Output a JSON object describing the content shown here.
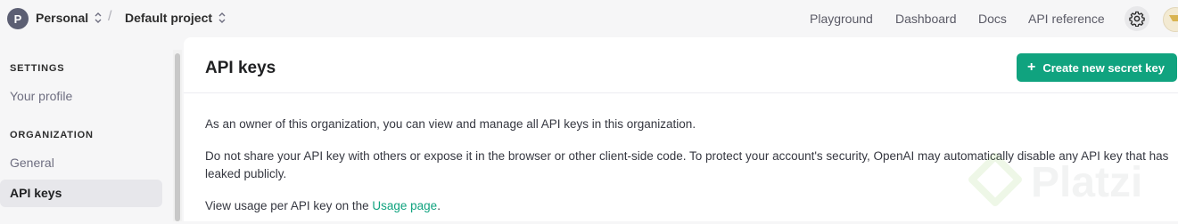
{
  "topbar": {
    "org_initial": "P",
    "org_name": "Personal",
    "separator": "/",
    "project_name": "Default project",
    "nav": [
      "Playground",
      "Dashboard",
      "Docs",
      "API reference"
    ]
  },
  "sidebar": {
    "sections": [
      {
        "heading": "SETTINGS",
        "items": [
          "Your profile"
        ]
      },
      {
        "heading": "ORGANIZATION",
        "items": [
          "General",
          "API keys"
        ]
      }
    ],
    "active_item": "API keys"
  },
  "main": {
    "title": "API keys",
    "create_button": "Create new secret key",
    "paragraphs": {
      "p1": "As an owner of this organization, you can view and manage all API keys in this organization.",
      "p2": "Do not share your API key with others or expose it in the browser or other client-side code. To protect your account's security, OpenAI may automatically disable any API key that has leaked publicly.",
      "p3_before": "View usage per API key on the ",
      "p3_link": "Usage page",
      "p3_after": "."
    }
  },
  "watermark": {
    "text": "Platzi"
  },
  "colors": {
    "accent": "#10a37f",
    "active_bg": "#e7e7eb"
  },
  "icons": [
    "chevron-updown-icon",
    "gear-icon",
    "plus-icon",
    "user-avatar"
  ]
}
